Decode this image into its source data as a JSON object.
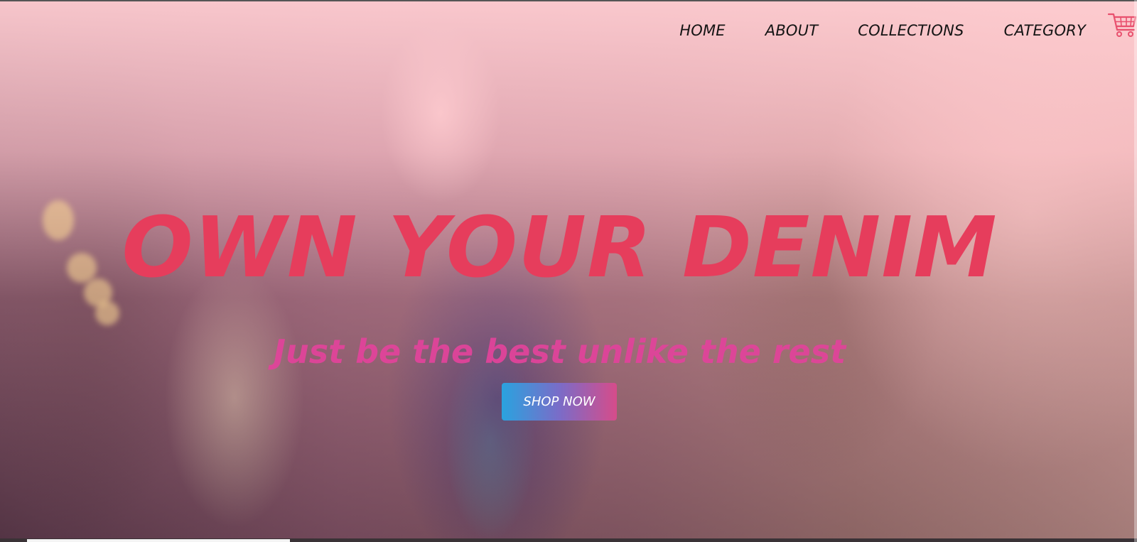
{
  "nav": {
    "items": [
      {
        "label": "HOME"
      },
      {
        "label": "ABOUT"
      },
      {
        "label": "COLLECTIONS"
      },
      {
        "label": "CATEGORY"
      }
    ],
    "cart_icon": "shopping-cart-icon",
    "cart_color": "#e8506e"
  },
  "hero": {
    "headline": "OWN YOUR DENIM",
    "subline": "Just be the best unlike the rest",
    "cta_label": "SHOP NOW",
    "headline_color": "#e63d5c",
    "subline_color": "#e0449a"
  }
}
